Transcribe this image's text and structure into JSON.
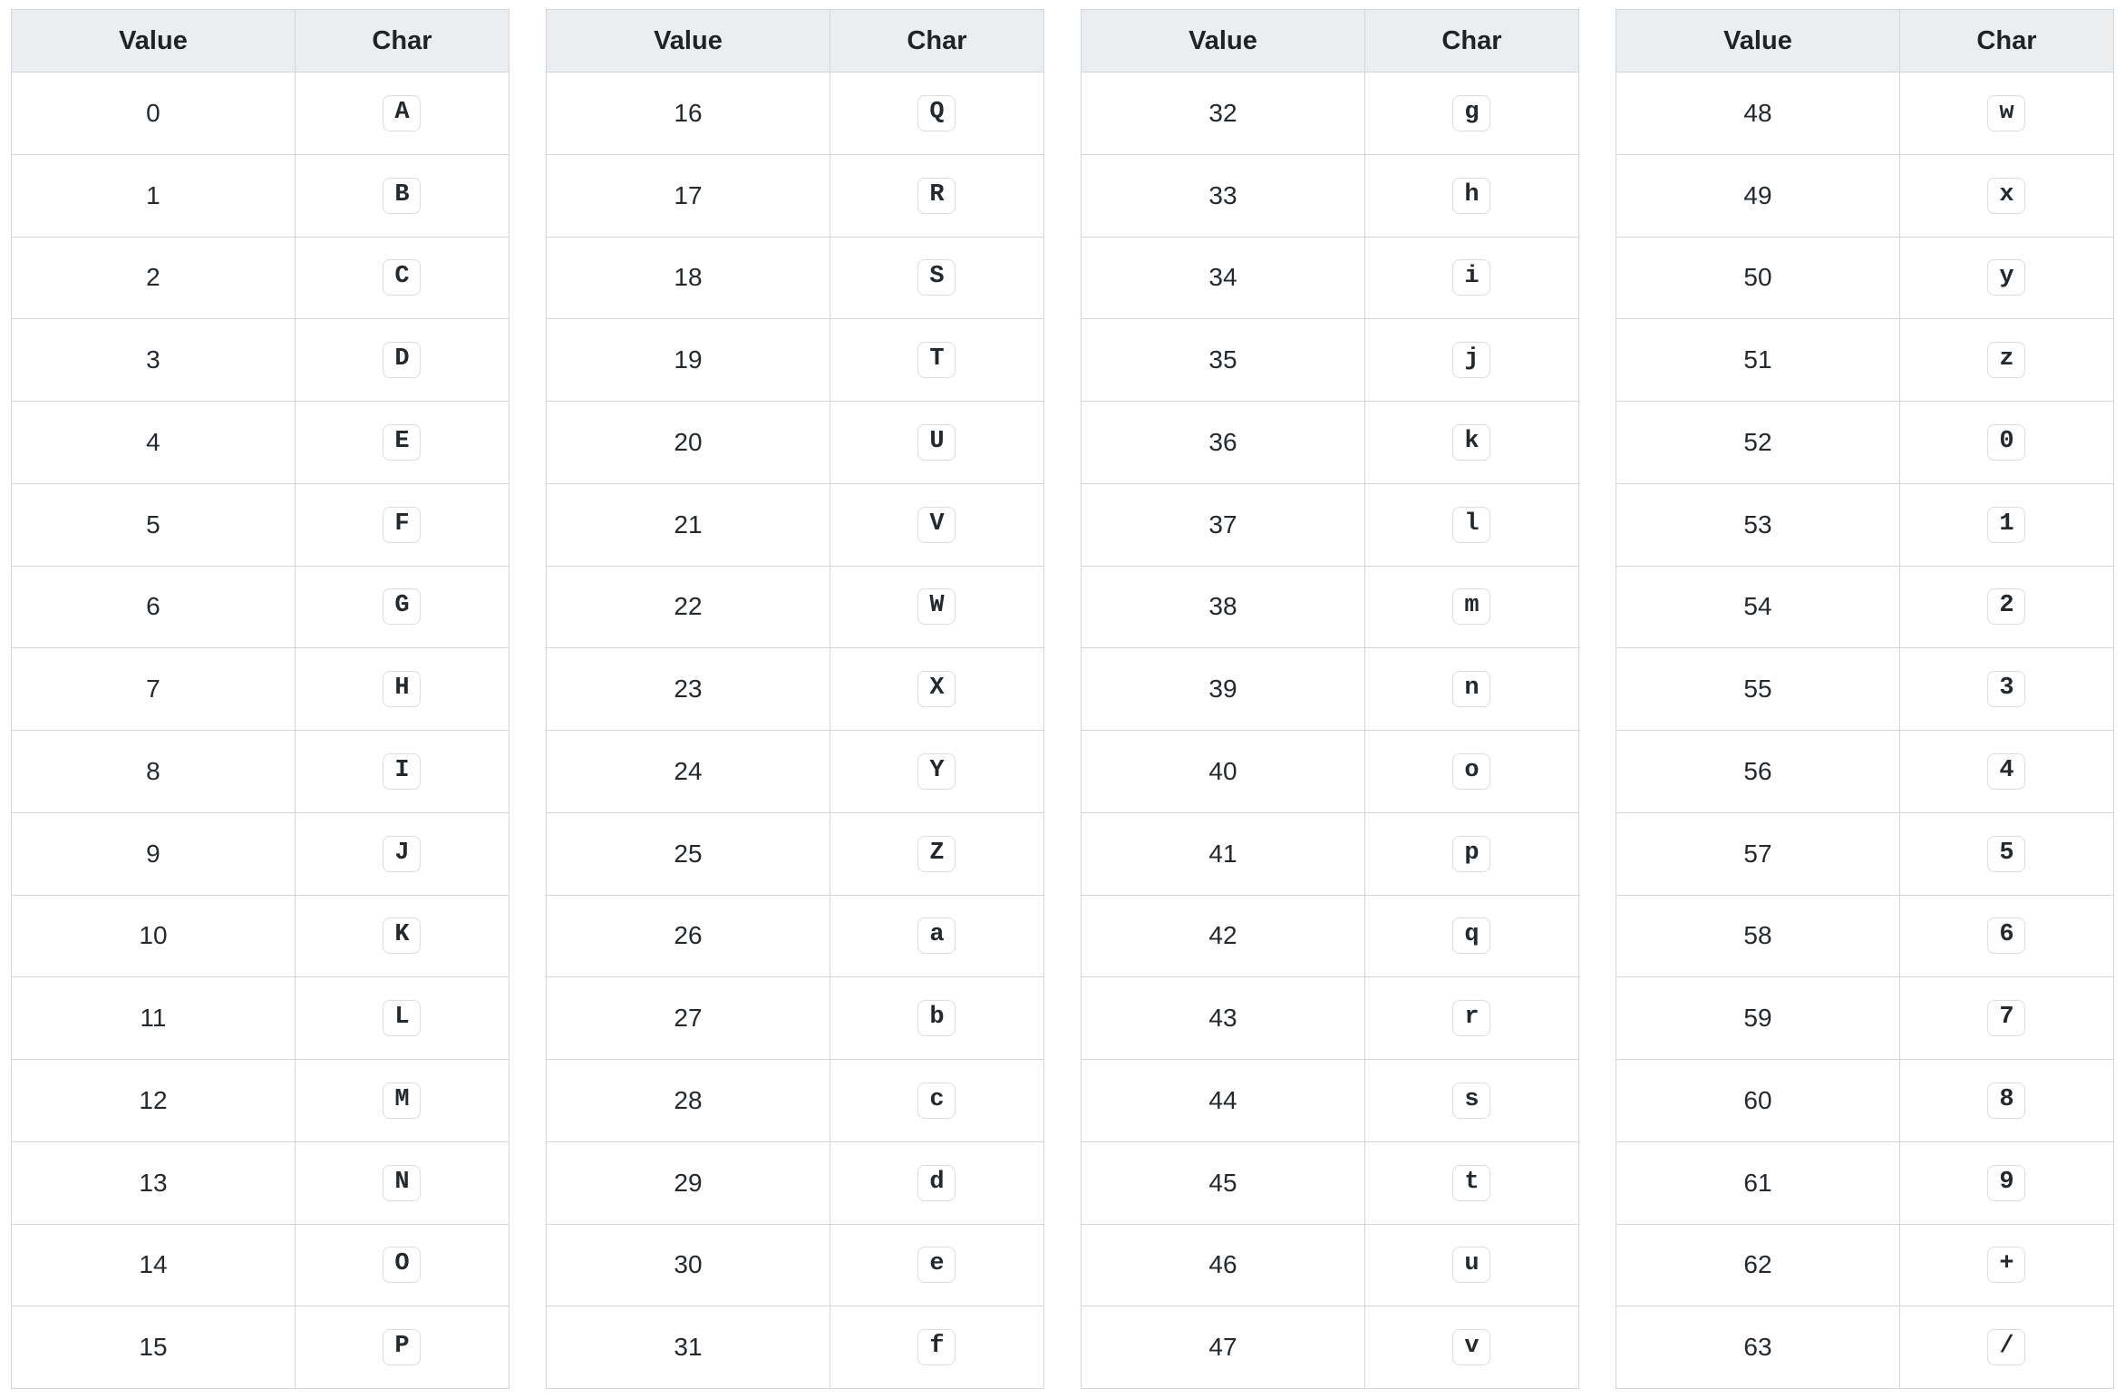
{
  "headers": {
    "value": "Value",
    "char": "Char"
  },
  "columns": [
    {
      "rows": [
        {
          "value": "0",
          "char": "A"
        },
        {
          "value": "1",
          "char": "B"
        },
        {
          "value": "2",
          "char": "C"
        },
        {
          "value": "3",
          "char": "D"
        },
        {
          "value": "4",
          "char": "E"
        },
        {
          "value": "5",
          "char": "F"
        },
        {
          "value": "6",
          "char": "G"
        },
        {
          "value": "7",
          "char": "H"
        },
        {
          "value": "8",
          "char": "I"
        },
        {
          "value": "9",
          "char": "J"
        },
        {
          "value": "10",
          "char": "K"
        },
        {
          "value": "11",
          "char": "L"
        },
        {
          "value": "12",
          "char": "M"
        },
        {
          "value": "13",
          "char": "N"
        },
        {
          "value": "14",
          "char": "O"
        },
        {
          "value": "15",
          "char": "P"
        }
      ]
    },
    {
      "rows": [
        {
          "value": "16",
          "char": "Q"
        },
        {
          "value": "17",
          "char": "R"
        },
        {
          "value": "18",
          "char": "S"
        },
        {
          "value": "19",
          "char": "T"
        },
        {
          "value": "20",
          "char": "U"
        },
        {
          "value": "21",
          "char": "V"
        },
        {
          "value": "22",
          "char": "W"
        },
        {
          "value": "23",
          "char": "X"
        },
        {
          "value": "24",
          "char": "Y"
        },
        {
          "value": "25",
          "char": "Z"
        },
        {
          "value": "26",
          "char": "a"
        },
        {
          "value": "27",
          "char": "b"
        },
        {
          "value": "28",
          "char": "c"
        },
        {
          "value": "29",
          "char": "d"
        },
        {
          "value": "30",
          "char": "e"
        },
        {
          "value": "31",
          "char": "f"
        }
      ]
    },
    {
      "rows": [
        {
          "value": "32",
          "char": "g"
        },
        {
          "value": "33",
          "char": "h"
        },
        {
          "value": "34",
          "char": "i"
        },
        {
          "value": "35",
          "char": "j"
        },
        {
          "value": "36",
          "char": "k"
        },
        {
          "value": "37",
          "char": "l"
        },
        {
          "value": "38",
          "char": "m"
        },
        {
          "value": "39",
          "char": "n"
        },
        {
          "value": "40",
          "char": "o"
        },
        {
          "value": "41",
          "char": "p"
        },
        {
          "value": "42",
          "char": "q"
        },
        {
          "value": "43",
          "char": "r"
        },
        {
          "value": "44",
          "char": "s"
        },
        {
          "value": "45",
          "char": "t"
        },
        {
          "value": "46",
          "char": "u"
        },
        {
          "value": "47",
          "char": "v"
        }
      ]
    },
    {
      "rows": [
        {
          "value": "48",
          "char": "w"
        },
        {
          "value": "49",
          "char": "x"
        },
        {
          "value": "50",
          "char": "y"
        },
        {
          "value": "51",
          "char": "z"
        },
        {
          "value": "52",
          "char": "0"
        },
        {
          "value": "53",
          "char": "1"
        },
        {
          "value": "54",
          "char": "2"
        },
        {
          "value": "55",
          "char": "3"
        },
        {
          "value": "56",
          "char": "4"
        },
        {
          "value": "57",
          "char": "5"
        },
        {
          "value": "58",
          "char": "6"
        },
        {
          "value": "59",
          "char": "7"
        },
        {
          "value": "60",
          "char": "8"
        },
        {
          "value": "61",
          "char": "9"
        },
        {
          "value": "62",
          "char": "+"
        },
        {
          "value": "63",
          "char": "/"
        }
      ]
    }
  ]
}
